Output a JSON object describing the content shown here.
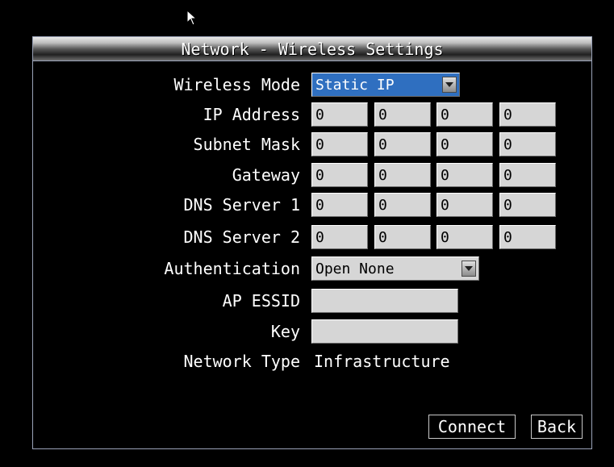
{
  "window": {
    "title": "Network - Wireless Settings"
  },
  "fields": {
    "wireless_mode": {
      "label": "Wireless Mode",
      "value": "Static IP"
    },
    "ip_address": {
      "label": "IP Address",
      "octets": [
        "0",
        "0",
        "0",
        "0"
      ]
    },
    "subnet_mask": {
      "label": "Subnet Mask",
      "octets": [
        "0",
        "0",
        "0",
        "0"
      ]
    },
    "gateway": {
      "label": "Gateway",
      "octets": [
        "0",
        "0",
        "0",
        "0"
      ]
    },
    "dns1": {
      "label": "DNS Server 1",
      "octets": [
        "0",
        "0",
        "0",
        "0"
      ]
    },
    "dns2": {
      "label": "DNS Server 2",
      "octets": [
        "0",
        "0",
        "0",
        "0"
      ]
    },
    "authentication": {
      "label": "Authentication",
      "value": "Open None"
    },
    "ap_essid": {
      "label": "AP ESSID",
      "value": ""
    },
    "key": {
      "label": "Key",
      "value": ""
    },
    "network_type": {
      "label": "Network Type",
      "value": "Infrastructure"
    }
  },
  "buttons": {
    "connect": "Connect",
    "back": "Back"
  },
  "colors": {
    "selected_field": "#2f6fc0",
    "field_bg": "#d6d6d6",
    "border": "#9aa3b8"
  },
  "icons": {
    "cursor": "mouse-pointer-icon",
    "dropdown": "chevron-down-icon"
  }
}
